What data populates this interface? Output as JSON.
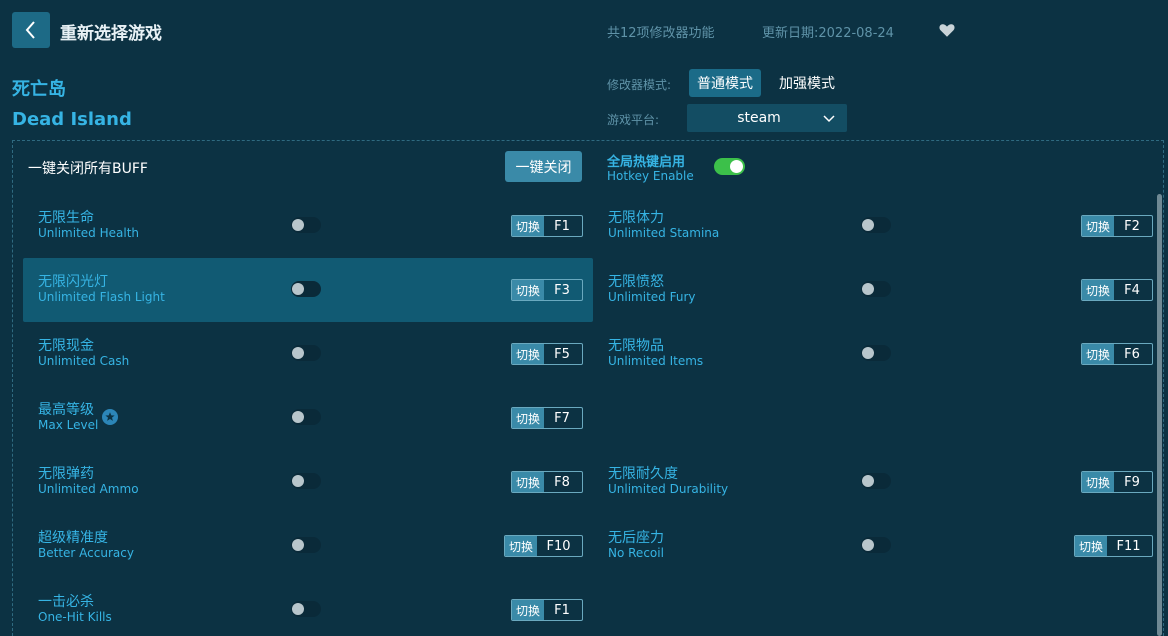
{
  "header": {
    "title": "重新选择游戏",
    "feature_count": "共12项修改器功能",
    "update_date": "更新日期:2022-08-24"
  },
  "game": {
    "name_cn": "死亡岛",
    "name_en": "Dead Island"
  },
  "mode": {
    "label": "修改器模式:",
    "normal": "普通模式",
    "boost": "加强模式",
    "selected": "普通模式"
  },
  "platform": {
    "label": "游戏平台:",
    "value": "steam"
  },
  "controls": {
    "close_all_label": "一键关闭所有BUFF",
    "close_all_button": "一键关闭",
    "hotkey_cn": "全局热键启用",
    "hotkey_en": "Hotkey Enable",
    "hotkey_enabled": true
  },
  "cheats": [
    {
      "cn": "无限生命",
      "en": "Unlimited Health",
      "switch": "切换",
      "key": "F1",
      "enabled": false
    },
    {
      "cn": "无限体力",
      "en": "Unlimited Stamina",
      "switch": "切换",
      "key": "F2",
      "enabled": false
    },
    {
      "cn": "无限闪光灯",
      "en": "Unlimited Flash Light",
      "switch": "切换",
      "key": "F3",
      "enabled": false
    },
    {
      "cn": "无限愤怒",
      "en": "Unlimited Fury",
      "switch": "切换",
      "key": "F4",
      "enabled": false
    },
    {
      "cn": "无限现金",
      "en": "Unlimited Cash",
      "switch": "切换",
      "key": "F5",
      "enabled": false
    },
    {
      "cn": "无限物品",
      "en": "Unlimited Items",
      "switch": "切换",
      "key": "F6",
      "enabled": false
    },
    {
      "cn": "最高等级",
      "en": "Max Level",
      "switch": "切换",
      "key": "F7",
      "enabled": false
    },
    {
      "cn": "无限弹药",
      "en": "Unlimited Ammo",
      "switch": "切换",
      "key": "F8",
      "enabled": false
    },
    {
      "cn": "无限耐久度",
      "en": "Unlimited Durability",
      "switch": "切换",
      "key": "F9",
      "enabled": false
    },
    {
      "cn": "超级精准度",
      "en": "Better Accuracy",
      "switch": "切换",
      "key": "F10",
      "enabled": false
    },
    {
      "cn": "无后座力",
      "en": "No Recoil",
      "switch": "切换",
      "key": "F11",
      "enabled": false
    },
    {
      "cn": "一击必杀",
      "en": "One-Hit Kills",
      "switch": "切换",
      "key": "F1",
      "enabled": false
    }
  ],
  "colors": {
    "background": "#0c3243",
    "accent": "#36b4e4",
    "highlight_row": "#115a73",
    "toggle_on": "#3cc04a"
  }
}
